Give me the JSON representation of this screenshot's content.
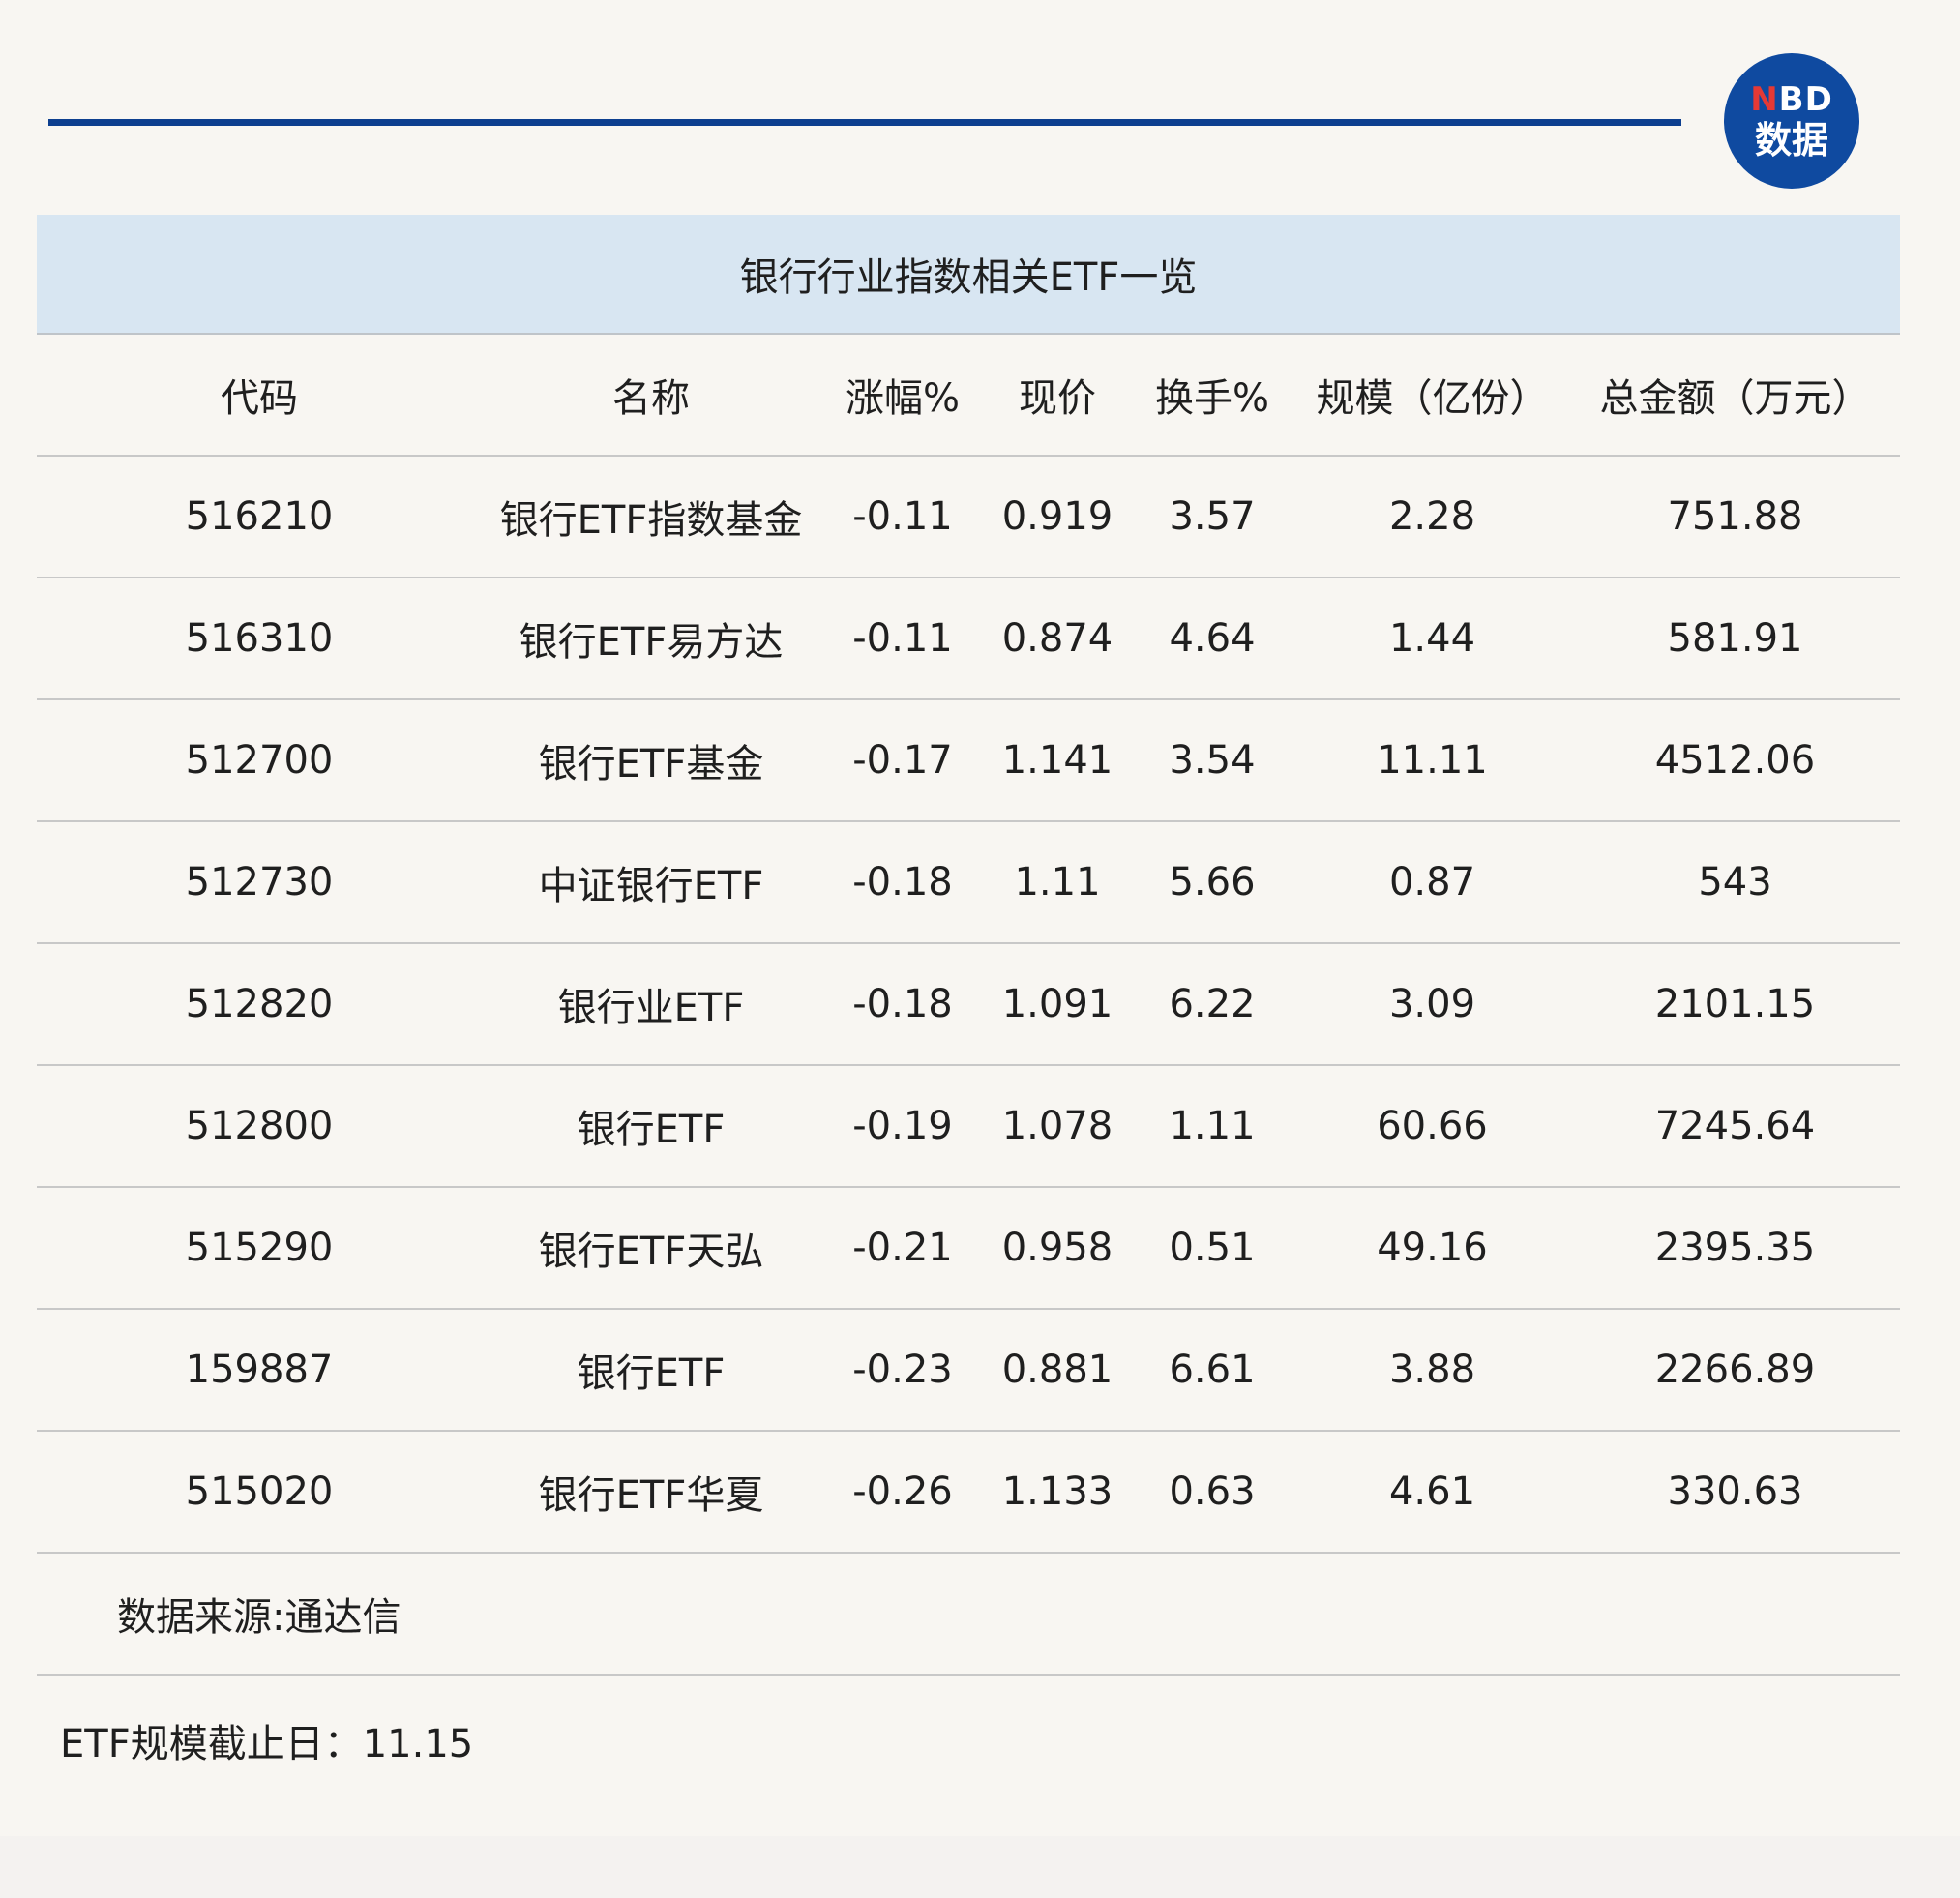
{
  "logo": {
    "line1_n": "N",
    "line1_rest": "BD",
    "line2": "数据"
  },
  "table": {
    "title": "银行行业指数相关ETF一览",
    "headers": [
      "代码",
      "名称",
      "涨幅%",
      "现价",
      "换手%",
      "规模（亿份）",
      "总金额（万元）"
    ],
    "rows": [
      [
        "516210",
        "银行ETF指数基金",
        "-0.11",
        "0.919",
        "3.57",
        "2.28",
        "751.88"
      ],
      [
        "516310",
        "银行ETF易方达",
        "-0.11",
        "0.874",
        "4.64",
        "1.44",
        "581.91"
      ],
      [
        "512700",
        "银行ETF基金",
        "-0.17",
        "1.141",
        "3.54",
        "11.11",
        "4512.06"
      ],
      [
        "512730",
        "中证银行ETF",
        "-0.18",
        "1.11",
        "5.66",
        "0.87",
        "543"
      ],
      [
        "512820",
        "银行业ETF",
        "-0.18",
        "1.091",
        "6.22",
        "3.09",
        "2101.15"
      ],
      [
        "512800",
        "银行ETF",
        "-0.19",
        "1.078",
        "1.11",
        "60.66",
        "7245.64"
      ],
      [
        "515290",
        "银行ETF天弘",
        "-0.21",
        "0.958",
        "0.51",
        "49.16",
        "2395.35"
      ],
      [
        "159887",
        "银行ETF",
        "-0.23",
        "0.881",
        "6.61",
        "3.88",
        "2266.89"
      ],
      [
        "515020",
        "银行ETF华夏",
        "-0.26",
        "1.133",
        "0.63",
        "4.61",
        "330.63"
      ]
    ],
    "source": "数据来源:通达信"
  },
  "footnote": "ETF规模截止日：11.15",
  "colors": {
    "accent_blue": "#0d3f8f",
    "title_band": "#d8e6f2",
    "background": "#f8f6f2",
    "logo_red": "#e53935"
  }
}
